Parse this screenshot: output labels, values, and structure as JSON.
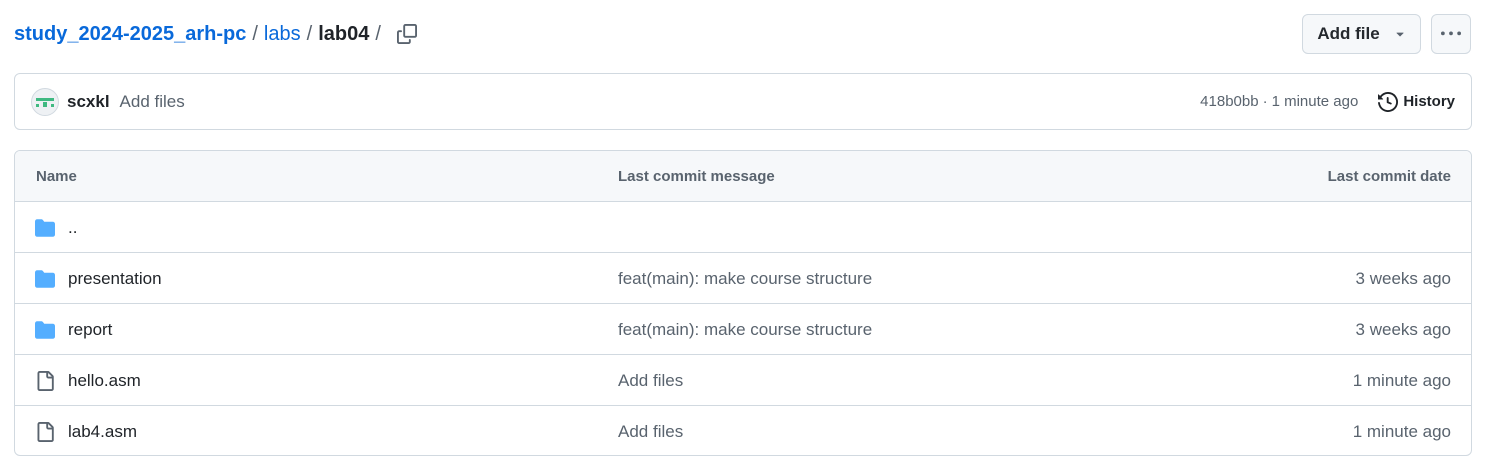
{
  "breadcrumb": {
    "repo": "study_2024-2025_arh-pc",
    "folder": "labs",
    "current": "lab04",
    "separator": "/"
  },
  "actions": {
    "add_file_label": "Add file",
    "more_icon": "kebab-horizontal-icon",
    "copy_icon": "copy-icon"
  },
  "latest_commit": {
    "author": "scxkl",
    "message": "Add files",
    "hash": "418b0bb",
    "dot": "·",
    "time": "1 minute ago",
    "history_label": "History"
  },
  "table": {
    "headers": {
      "name": "Name",
      "message": "Last commit message",
      "date": "Last commit date"
    },
    "rows": [
      {
        "type": "folder",
        "name": "..",
        "message": "",
        "date": ""
      },
      {
        "type": "folder",
        "name": "presentation",
        "message": "feat(main): make course structure",
        "date": "3 weeks ago"
      },
      {
        "type": "folder",
        "name": "report",
        "message": "feat(main): make course structure",
        "date": "3 weeks ago"
      },
      {
        "type": "file",
        "name": "hello.asm",
        "message": "Add files",
        "date": "1 minute ago"
      },
      {
        "type": "file",
        "name": "lab4.asm",
        "message": "Add files",
        "date": "1 minute ago"
      }
    ]
  },
  "colors": {
    "link": "#0969da",
    "folder": "#54aeff",
    "muted": "#59636e",
    "border": "#d1d9e0",
    "avatar_accent": "#3fb981"
  }
}
